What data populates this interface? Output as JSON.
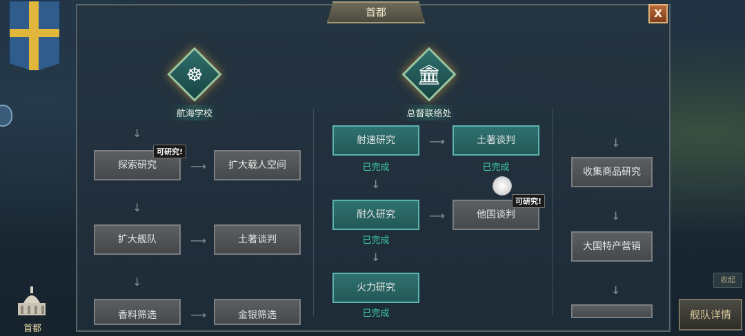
{
  "dialog": {
    "title": "首都",
    "close_label": "X"
  },
  "buildings": [
    {
      "name": "航海学校",
      "icon": "helm-icon"
    },
    {
      "name": "总督联络处",
      "icon": "government-building-icon"
    }
  ],
  "badge_text": "可研究!",
  "status_done": "已完成",
  "column1": [
    "探索研究",
    "扩大载人空间",
    "扩大舰队",
    "土著谈判",
    "香料筛选",
    "金银筛选"
  ],
  "column2": [
    "射速研究",
    "土著谈判",
    "耐久研究",
    "他国谈判",
    "火力研究"
  ],
  "column3": [
    "收集商品研究",
    "大国特产营销"
  ],
  "hud": {
    "capital_label": "首都",
    "collapse_label": "收起",
    "fleet_details_label": "舰队详情"
  }
}
